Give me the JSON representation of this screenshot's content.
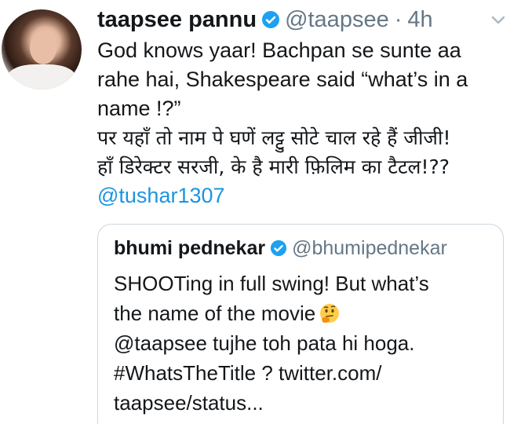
{
  "tweet": {
    "author_name": "taapsee pannu",
    "author_handle": "@taapsee",
    "separator": "·",
    "time": "4h",
    "lines": [
      "God knows yaar! Bachpan se sunte aa",
      "rahe hai, Shakespeare said “what’s in a",
      "name !?”"
    ],
    "hindi_lines": [
      "पर यहाँ तो नाम पे घणें लट्टु सोटे चाल रहे हैं जीजी!",
      "हाँ डिरेक्टर सरजी, के है मारी फ़िलिम का टैटल!??"
    ],
    "mention": "@tushar1307"
  },
  "quoted_tweet": {
    "author_name": "bhumi pednekar",
    "author_handle": "@bhumipednekar",
    "line1": "SHOOTing in full swing! But what’s",
    "line2": "the name of the movie",
    "line3": "@taapsee tujhe toh pata hi hoga.",
    "line4": "#WhatsTheTitle ? twitter.com/",
    "line5": "taapsee/status..."
  },
  "colors": {
    "link": "#1b95e0",
    "verified": "#1da1f2",
    "muted": "#657786",
    "border": "#ccd6dd"
  },
  "icons": {
    "verified": "verified-badge-icon",
    "menu": "chevron-down-icon",
    "emoji": "thinking-face-icon"
  }
}
